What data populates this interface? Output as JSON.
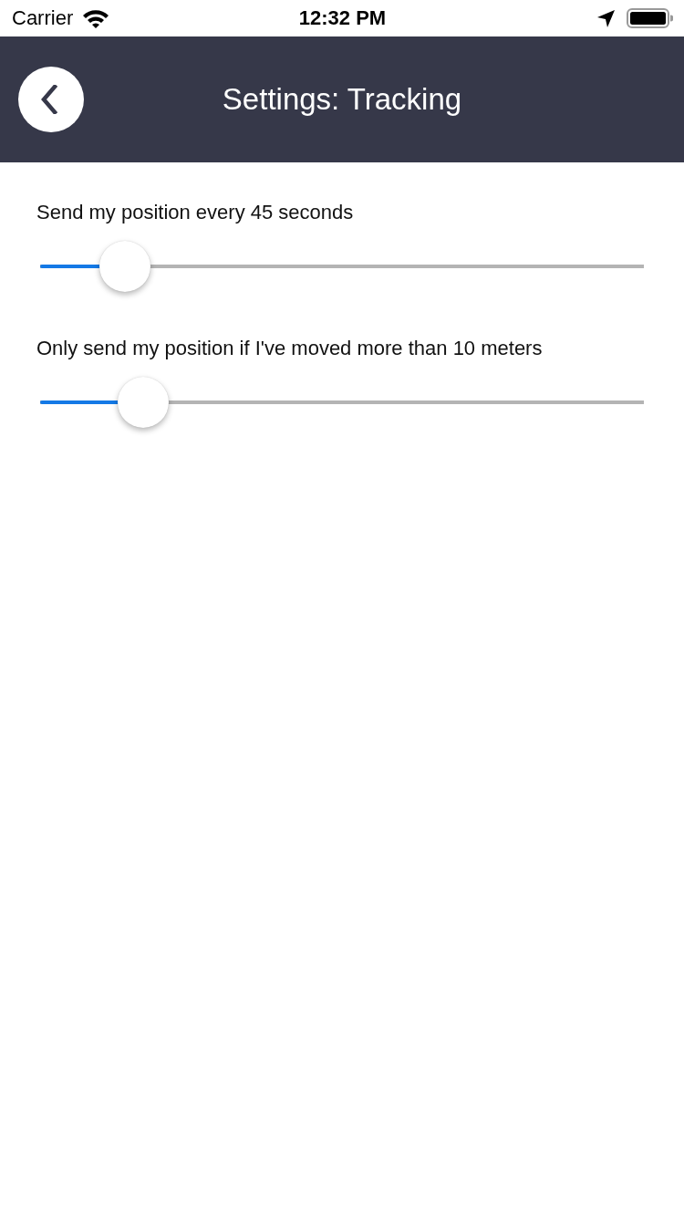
{
  "status_bar": {
    "carrier": "Carrier",
    "time": "12:32 PM"
  },
  "header": {
    "title": "Settings: Tracking"
  },
  "settings": [
    {
      "label": "Send my position every 45 seconds",
      "level": 0.14
    },
    {
      "label": "Only send my position if I've moved more than 10 meters",
      "level": 0.17
    }
  ]
}
